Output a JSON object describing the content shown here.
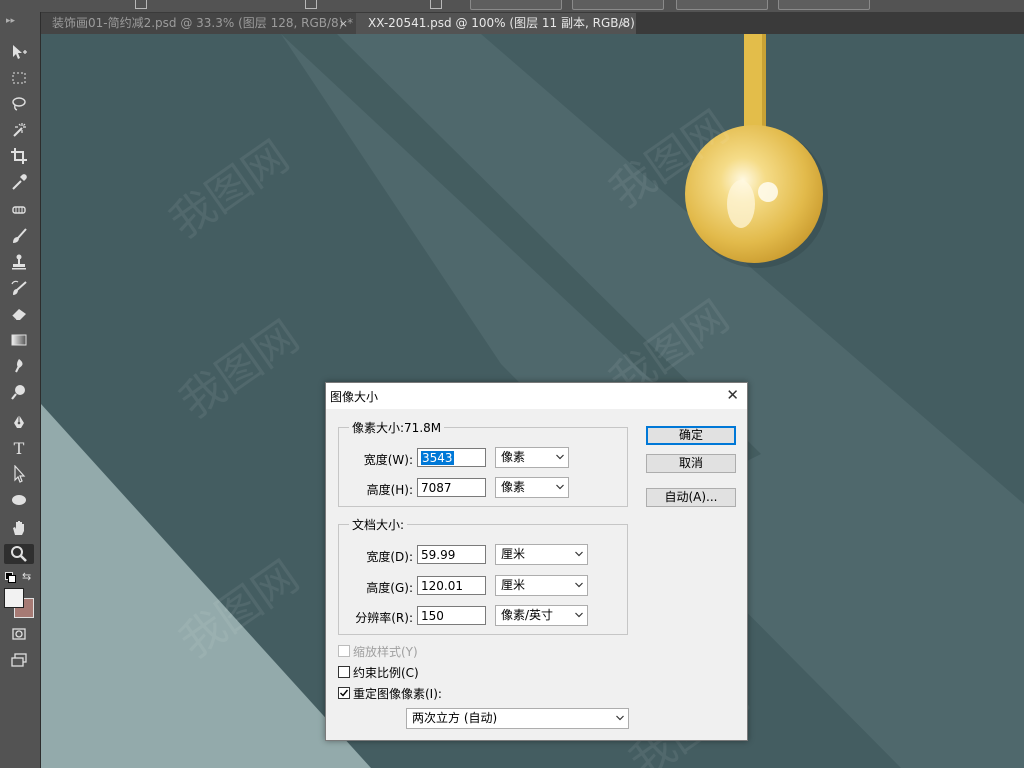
{
  "app": {
    "name": "Photoshop"
  },
  "tabs": [
    {
      "label": "装饰画01-简约减2.psd @ 33.3% (图层 128, RGB/8) *",
      "active": false,
      "close": "×"
    },
    {
      "label": "XX-20541.psd @ 100% (图层 11 副本, RGB/8)",
      "active": true,
      "close": "×"
    }
  ],
  "toolbar": {
    "tools": [
      "move-tool",
      "marquee-tool",
      "lasso-tool",
      "magic-wand-tool",
      "crop-tool",
      "eyedropper-tool",
      "healing-brush-tool",
      "brush-tool",
      "clone-stamp-tool",
      "history-brush-tool",
      "eraser-tool",
      "gradient-tool",
      "blur-tool",
      "dodge-tool",
      "pen-tool",
      "type-tool",
      "path-selection-tool",
      "ellipse-tool",
      "hand-tool",
      "zoom-tool"
    ],
    "active_tool": "zoom-tool",
    "text_tool_glyph": "T",
    "foreground_color": "#f2f2f2",
    "background_color": "#a67a74"
  },
  "canvas": {
    "colors": {
      "dark": "#445d61",
      "mid": "#4e676b",
      "light": "#93aaab",
      "gold": "#e3bd4a"
    },
    "watermark": "我图网"
  },
  "dialog": {
    "title": "图像大小",
    "close": "✕",
    "pixel_dimensions": {
      "legend": "像素大小:71.8M",
      "width_label": "宽度(W):",
      "width_value_selected": "3543",
      "width_unit": "像素",
      "height_label": "高度(H):",
      "height_value": "7087",
      "height_unit": "像素"
    },
    "document_size": {
      "legend": "文档大小:",
      "width_label": "宽度(D):",
      "width_value": "59.99",
      "width_unit": "厘米",
      "height_label": "高度(G):",
      "height_value": "120.01",
      "height_unit": "厘米",
      "resolution_label": "分辨率(R):",
      "resolution_value": "150",
      "resolution_unit": "像素/英寸"
    },
    "options": {
      "scale_styles": "缩放样式(Y)",
      "scale_styles_checked": false,
      "scale_styles_disabled": true,
      "constrain": "约束比例(C)",
      "constrain_checked": false,
      "resample": "重定图像像素(I):",
      "resample_checked": true,
      "resample_method": "两次立方 (自动)"
    },
    "buttons": {
      "ok": "确定",
      "cancel": "取消",
      "auto": "自动(A)..."
    }
  }
}
